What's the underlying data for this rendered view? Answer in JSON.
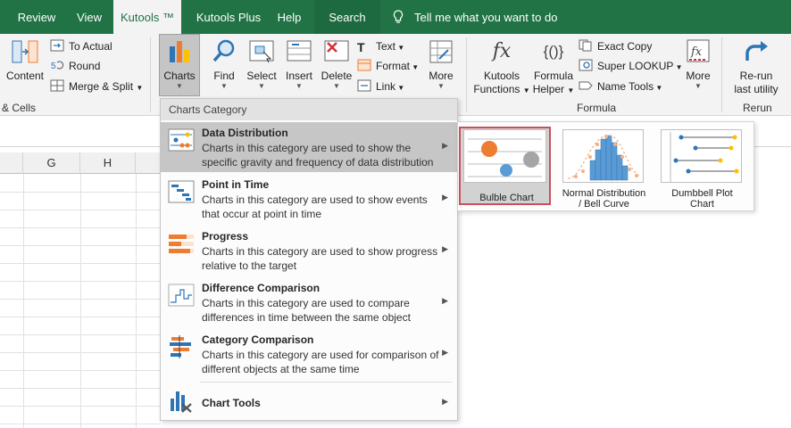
{
  "tabs": [
    {
      "label": "Review"
    },
    {
      "label": "View"
    },
    {
      "label": "Kutools ™"
    },
    {
      "label": "Kutools Plus"
    },
    {
      "label": "Help"
    },
    {
      "label": "Search"
    }
  ],
  "tell_me": "Tell me what you want to do",
  "ribbon": {
    "content": {
      "label": "Content"
    },
    "to_actual": "To Actual",
    "round": "Round",
    "merge_split": "Merge & Split",
    "cells_group": "& Cells",
    "charts": "Charts",
    "find": "Find",
    "select": "Select",
    "insert": "Insert",
    "delete": "Delete",
    "text": "Text",
    "format": "Format",
    "link": "Link",
    "more": "More",
    "kutools_functions_1": "Kutools",
    "kutools_functions_2": "Functions",
    "formula_helper_1": "Formula",
    "formula_helper_2": "Helper",
    "exact_copy": "Exact Copy",
    "super_lookup": "Super LOOKUP",
    "name_tools": "Name Tools",
    "more2": "More",
    "formula_group": "Formula",
    "rerun_1": "Re-run",
    "rerun_2": "last utility",
    "rerun_group": "Rerun",
    "fx_glyph": "fx",
    "braces_glyph": "{()}"
  },
  "columns": [
    "G",
    "H"
  ],
  "menu": {
    "header": "Charts Category",
    "items": [
      {
        "title": "Data Distribution",
        "desc": "Charts in this category are used to show the specific gravity and frequency of data distribution",
        "icon": "scatter-icon"
      },
      {
        "title": "Point in Time",
        "desc": "Charts in this category are used to show events that occur at point in time",
        "icon": "timeline-icon"
      },
      {
        "title": "Progress",
        "desc": "Charts in this category are used to show progress relative to the target",
        "icon": "progress-icon"
      },
      {
        "title": "Difference Comparison",
        "desc": "Charts in this category are used to compare differences in time between the same object",
        "icon": "step-icon"
      },
      {
        "title": "Category Comparison",
        "desc": "Charts in this category are used for comparison of different objects at the same time",
        "icon": "bars-icon"
      },
      {
        "title": "Chart Tools",
        "desc": "",
        "icon": "tools-icon"
      }
    ]
  },
  "submenu": {
    "cards": [
      {
        "label": "Bulble Chart"
      },
      {
        "label_1": "Normal Distribution",
        "label_2": "/ Bell Curve"
      },
      {
        "label_1": "Dumbbell Plot",
        "label_2": "Chart"
      }
    ]
  },
  "colors": {
    "excel_green": "#217346",
    "accent_blue": "#2e75b6",
    "orange": "#ed7d31",
    "yellow": "#ffc000",
    "selection_border": "#c8505c"
  }
}
